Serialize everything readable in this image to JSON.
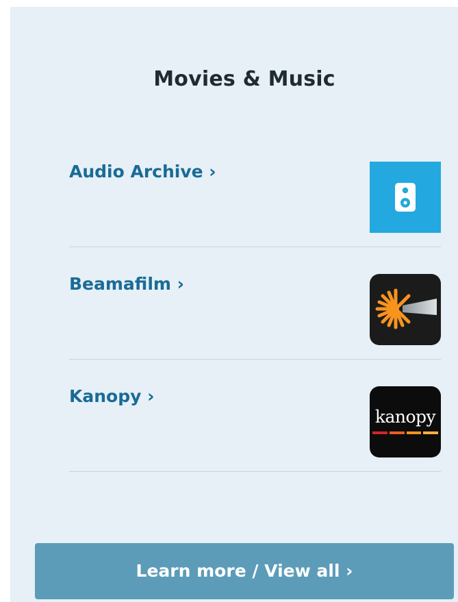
{
  "section": {
    "title": "Movies & Music"
  },
  "items": [
    {
      "label": "Audio Archive ›",
      "icon": "speaker-icon",
      "color": "#23a8df"
    },
    {
      "label": "Beamafilm ›",
      "icon": "beamafilm-logo",
      "color": "#1b1b1b"
    },
    {
      "label": "Kanopy ›",
      "icon": "kanopy-logo",
      "logo_text": "kanopy",
      "color": "#0c0c0c"
    }
  ],
  "cta": {
    "label": "Learn more / View all ›"
  },
  "colors": {
    "panel_bg": "#e6f0f6",
    "link": "#1a6b96",
    "button": "#5c9cb8",
    "kanopy_stripes": [
      "#d2232a",
      "#f15a24",
      "#f7931e",
      "#fbb03b"
    ],
    "beamafilm_rays": "#f7941d"
  }
}
